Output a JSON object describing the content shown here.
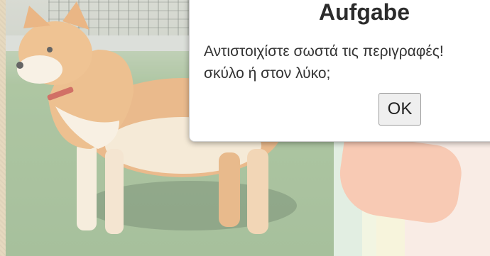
{
  "dialog": {
    "title": "Aufgabe",
    "message": "Αντιστοιχίστε σωστά τις περιγραφές!\nσκύλο ή στον λύκο;",
    "ok_label": "OK"
  },
  "background": {
    "photo_subject": "shiba-inu-dog",
    "colors": {
      "frame": "#e6d9bf",
      "grass": "#8fb07f",
      "accent": "#f6b89b"
    }
  }
}
